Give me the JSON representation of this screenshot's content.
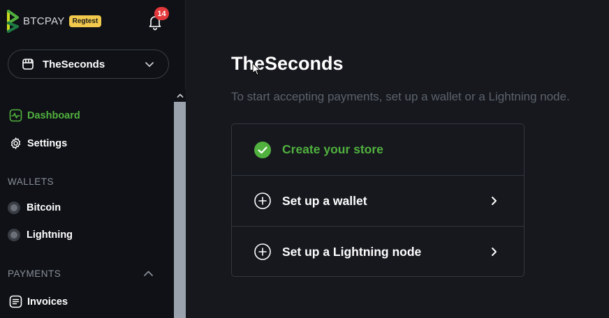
{
  "brand": {
    "name": "BTCPAY",
    "env_badge": "Regtest",
    "logo_colors": [
      "#51b13e",
      "#cedc21",
      "#1e7a44"
    ]
  },
  "notifications": {
    "count": "14",
    "icon": "bell-icon"
  },
  "store_selector": {
    "name": "TheSeconds",
    "icon": "store-icon"
  },
  "nav": {
    "dashboard": {
      "label": "Dashboard",
      "icon": "activity-icon",
      "active": true
    },
    "settings": {
      "label": "Settings",
      "icon": "gear-icon"
    },
    "wallets_title": "WALLETS",
    "wallets": [
      {
        "label": "Bitcoin",
        "icon": "status-dot-icon"
      },
      {
        "label": "Lightning",
        "icon": "status-dot-icon"
      }
    ],
    "payments_title": "PAYMENTS",
    "payments": [
      {
        "label": "Invoices",
        "icon": "invoice-icon"
      }
    ]
  },
  "main": {
    "title": "TheSeconds",
    "subtitle": "To start accepting payments, set up a wallet or a Lightning node.",
    "steps": [
      {
        "label": "Create your store",
        "status": "done",
        "icon": "check-circle-icon"
      },
      {
        "label": "Set up a wallet",
        "status": "todo",
        "icon": "plus-circle-icon"
      },
      {
        "label": "Set up a Lightning node",
        "status": "todo",
        "icon": "plus-circle-icon"
      }
    ]
  },
  "colors": {
    "accent": "#51b13e",
    "badge": "#f2c94c",
    "notification": "#e2383b",
    "background": "#16181e",
    "sidebar": "#0f1116"
  }
}
